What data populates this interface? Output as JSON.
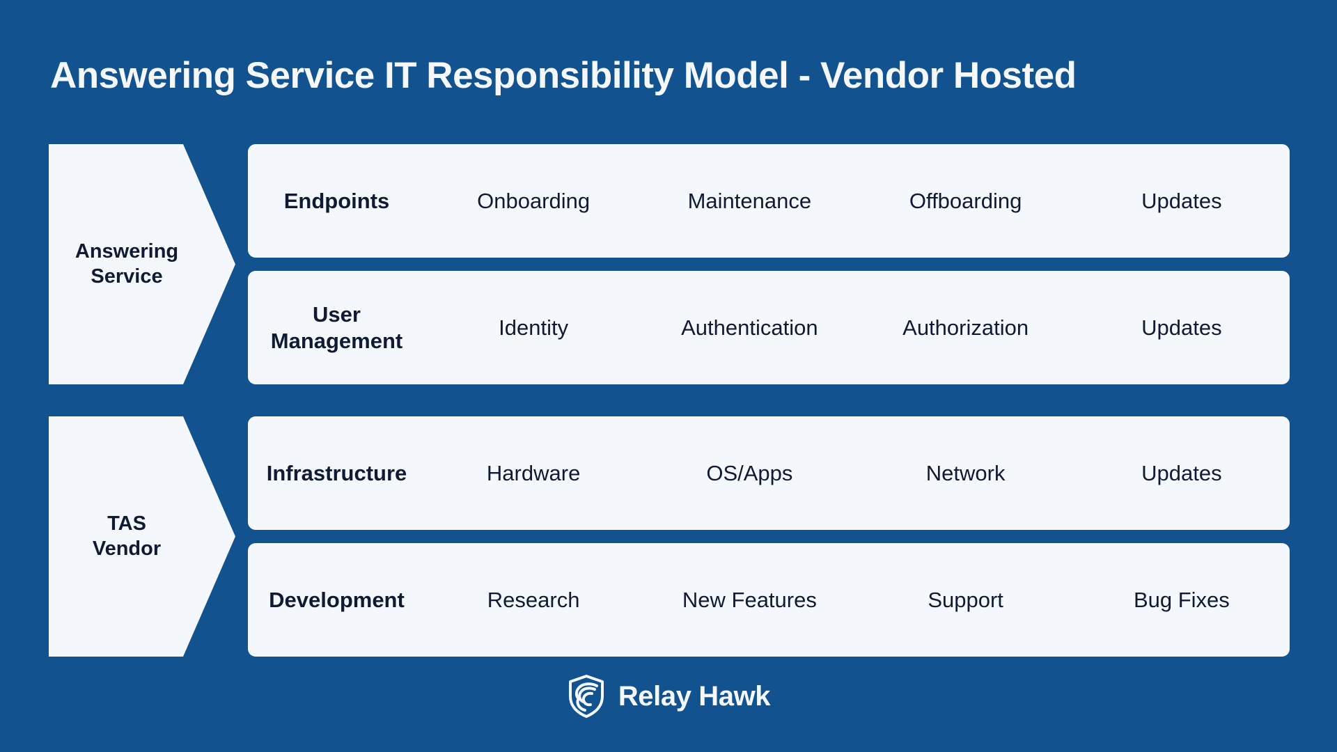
{
  "page": {
    "title": "Answering Service IT Responsibility Model - Vendor Hosted",
    "background_color": "#11528F",
    "panel_color": "#F4F8FC",
    "text_color": "#111A33"
  },
  "groups": [
    {
      "label": "Answering Service",
      "label_line1": "Answering",
      "label_line2": "Service",
      "rows": [
        {
          "heading": "Endpoints",
          "items": [
            "Onboarding",
            "Maintenance",
            "Offboarding",
            "Updates"
          ]
        },
        {
          "heading": "User Management",
          "heading_line1": "User",
          "heading_line2": "Management",
          "items": [
            "Identity",
            "Authentication",
            "Authorization",
            "Updates"
          ]
        }
      ]
    },
    {
      "label": "TAS Vendor",
      "label_line1": "TAS",
      "label_line2": "Vendor",
      "rows": [
        {
          "heading": "Infrastructure",
          "items": [
            "Hardware",
            "OS/Apps",
            "Network",
            "Updates"
          ]
        },
        {
          "heading": "Development",
          "items": [
            "Research",
            "New Features",
            "Support",
            "Bug Fixes"
          ]
        }
      ]
    }
  ],
  "footer": {
    "brand_name": "Relay Hawk",
    "logo_icon": "shield-hawk-icon"
  }
}
